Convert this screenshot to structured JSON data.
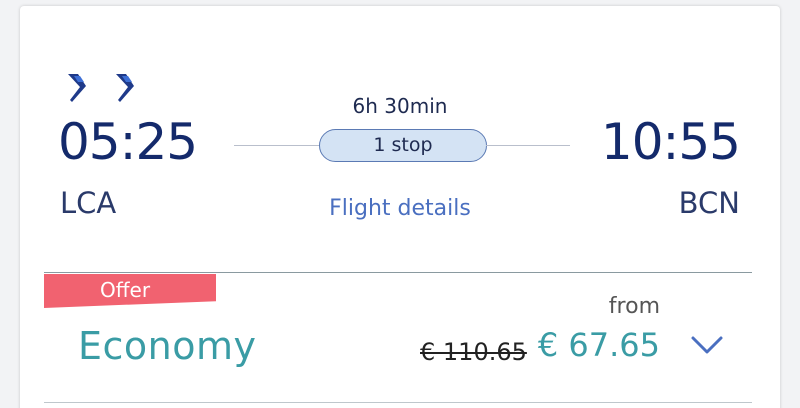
{
  "flight": {
    "departure": {
      "time": "05:25",
      "airport": "LCA"
    },
    "arrival": {
      "time": "10:55",
      "airport": "BCN"
    },
    "duration": "6h 30min",
    "stops": "1 stop",
    "details_link": "Flight details"
  },
  "fare": {
    "badge": "Offer",
    "cabin": "Economy",
    "from_label": "from",
    "original_price": "€ 110.65",
    "price": "€ 67.65"
  },
  "colors": {
    "time": "#142a6b",
    "accent": "#3a9ca5",
    "link": "#4a6fc0",
    "offer": "#f16270",
    "pill_bg": "#d4e3f4"
  },
  "icons": {
    "airline": "airline-logo-icon",
    "expand": "chevron-down-icon"
  }
}
